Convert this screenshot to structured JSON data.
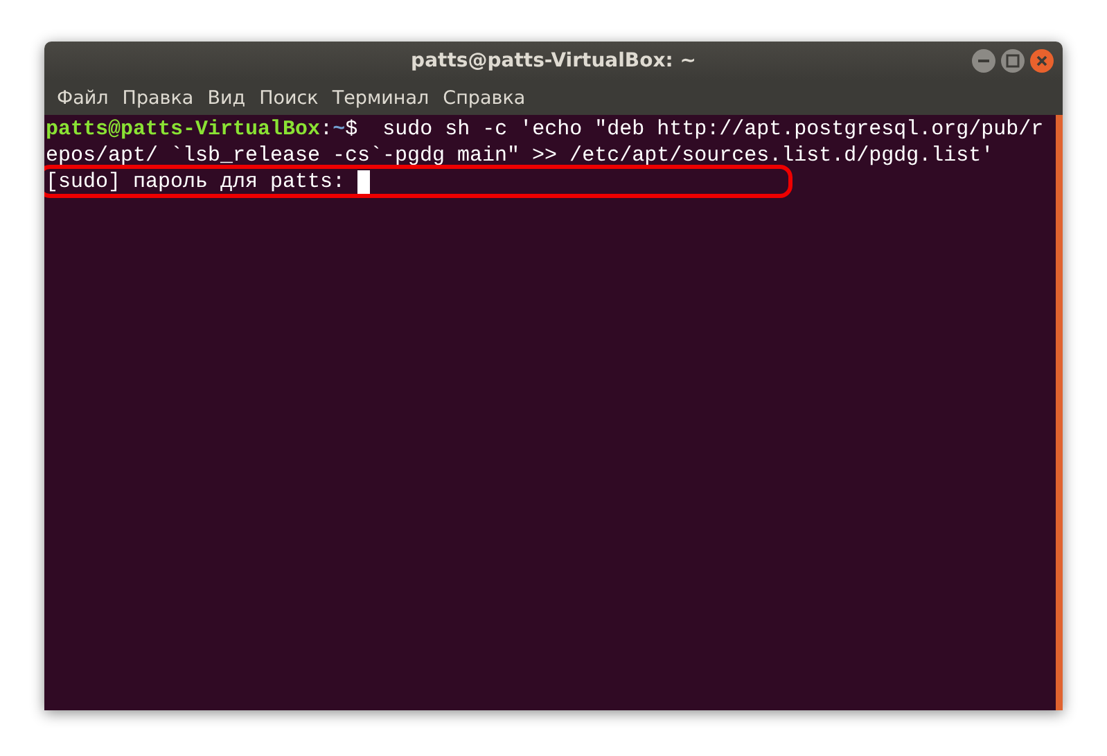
{
  "window": {
    "title": "patts@patts-VirtualBox: ~"
  },
  "menu": [
    "Файл",
    "Правка",
    "Вид",
    "Поиск",
    "Терминал",
    "Справка"
  ],
  "terminal": {
    "lines": [
      {
        "segments": [
          {
            "kind": "user",
            "text": "patts@patts-VirtualBox"
          },
          {
            "kind": "plain",
            "text": ":"
          },
          {
            "kind": "path",
            "text": "~"
          },
          {
            "kind": "plain",
            "text": "$  sudo sh -c 'echo \"deb http://apt.postgresql.org/pub/r"
          }
        ],
        "highlighted": false,
        "cursor": false
      },
      {
        "segments": [
          {
            "kind": "plain",
            "text": "epos/apt/ `lsb_release -cs`-pgdg main\" >> /etc/apt/sources.list.d/pgdg.list'"
          }
        ],
        "highlighted": false,
        "cursor": false
      },
      {
        "segments": [
          {
            "kind": "plain",
            "text": "[sudo] пароль для patts: "
          }
        ],
        "highlighted": true,
        "cursor": true
      }
    ]
  }
}
